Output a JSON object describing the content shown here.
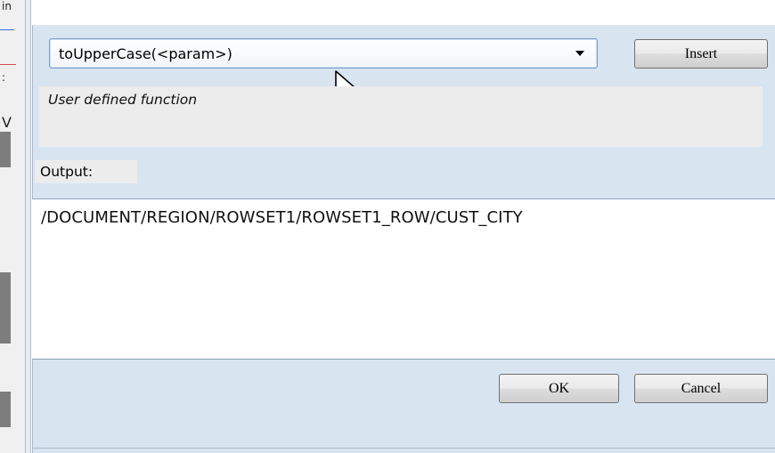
{
  "background_window": {
    "fragments": [
      "in",
      ":",
      "V"
    ]
  },
  "function_select": {
    "value": "toUpperCase(<param>)"
  },
  "insert_button": {
    "label": "Insert"
  },
  "description": {
    "text": "User defined function"
  },
  "output": {
    "label": "Output:",
    "value": "/DOCUMENT/REGION/ROWSET1/ROWSET1_ROW/CUST_CITY"
  },
  "footer": {
    "ok_label": "OK",
    "cancel_label": "Cancel"
  },
  "colors": {
    "panel_bg": "#d9e4f1",
    "description_bg": "#ececec",
    "combo_border": "#7a9cc7"
  }
}
